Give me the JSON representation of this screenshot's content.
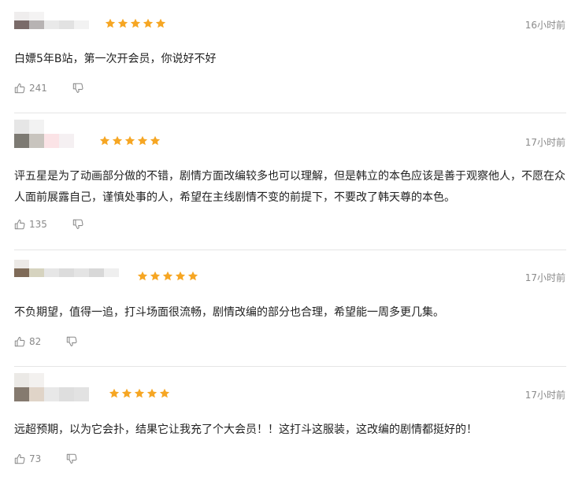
{
  "accent_color": "#f6a623",
  "reviews": [
    {
      "stars": 5,
      "time": "16小时前",
      "content": "白嫖5年B站，第一次开会员，你说好不好",
      "likes": "241"
    },
    {
      "stars": 5,
      "time": "17小时前",
      "content": "评五星是为了动画部分做的不错，剧情方面改编较多也可以理解，但是韩立的本色应该是善于观察他人，不愿在众人面前展露自己，谨慎处事的人，希望在主线剧情不变的前提下，不要改了韩天尊的本色。",
      "likes": "135"
    },
    {
      "stars": 5,
      "time": "17小时前",
      "content": "不负期望，值得一追，打斗场面很流畅，剧情改编的部分也合理，希望能一周多更几集。",
      "likes": "82"
    },
    {
      "stars": 5,
      "time": "17小时前",
      "content": "远超预期，以为它会扑，结果它让我充了个大会员！！这打斗这服装，这改编的剧情都挺好的！",
      "likes": "73"
    }
  ]
}
